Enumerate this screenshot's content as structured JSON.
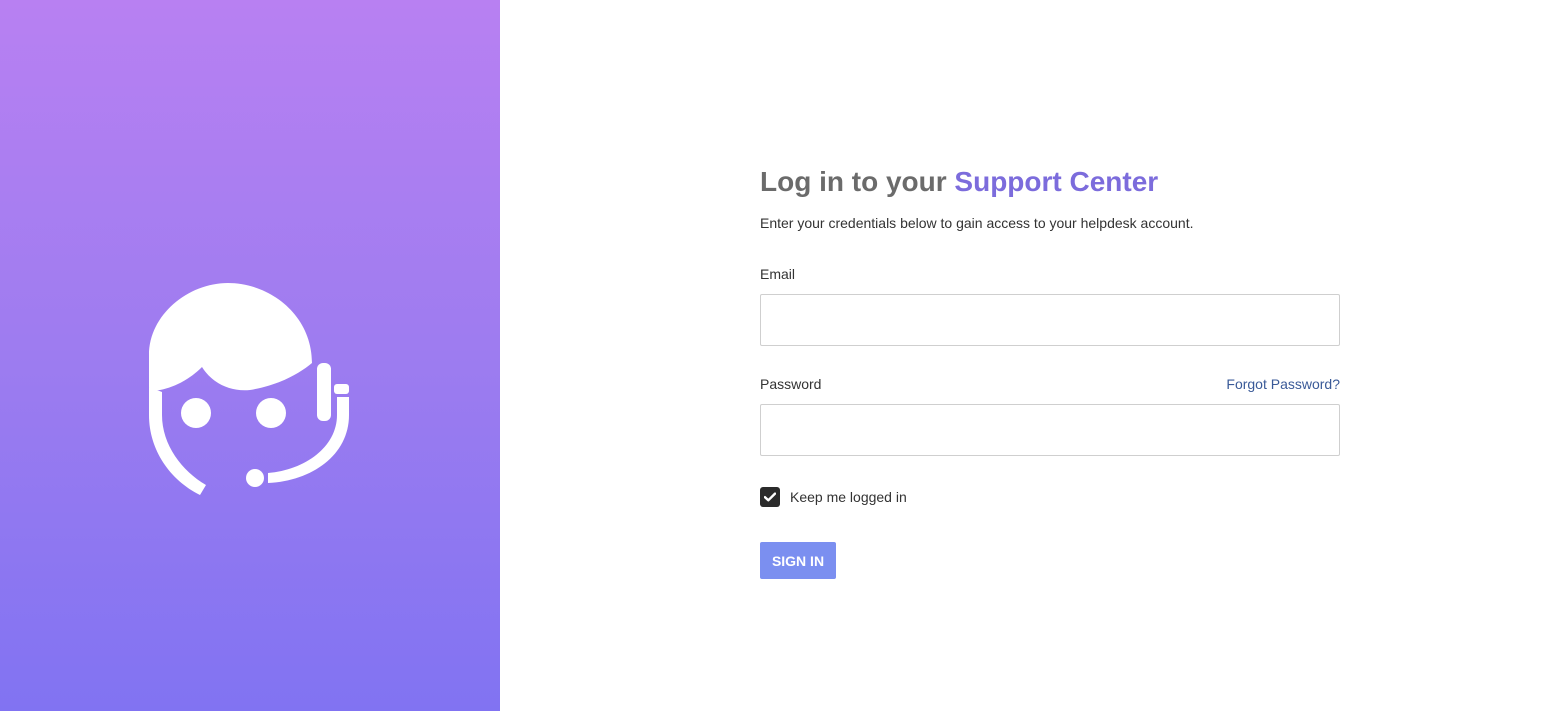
{
  "branding": {
    "logo_icon": "support-agent-headset-icon",
    "gradient_top": "#b880f2",
    "gradient_bottom": "#8173f2"
  },
  "login": {
    "heading_prefix": "Log in to your ",
    "heading_accent": "Support Center",
    "subtitle": "Enter your credentials below to gain access to your helpdesk account.",
    "email_label": "Email",
    "email_value": "",
    "password_label": "Password",
    "password_value": "",
    "forgot_password_label": "Forgot Password?",
    "remember_label": "Keep me logged in",
    "remember_checked": true,
    "signin_label": "SIGN IN"
  },
  "colors": {
    "accent": "#7c6cdc",
    "button": "#7b8ff0",
    "link": "#3a5a98"
  }
}
